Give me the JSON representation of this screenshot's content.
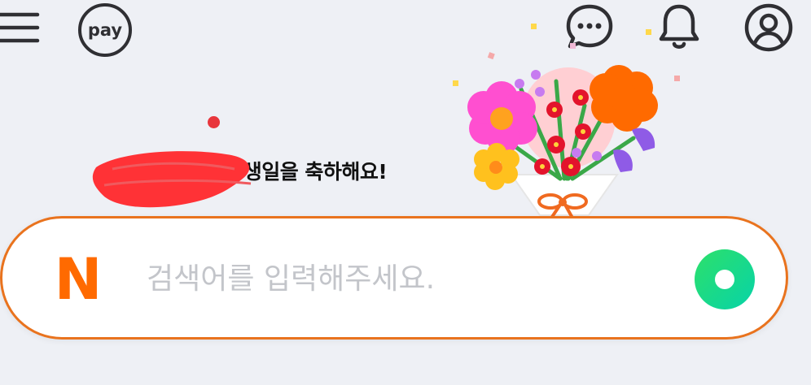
{
  "header": {
    "menu_icon": "hamburger-menu-icon",
    "pay_label": "pay",
    "talk_icon": "talk-bubble-icon",
    "notification_icon": "bell-icon",
    "profile_icon": "user-profile-icon"
  },
  "greeting": {
    "name_redacted": "",
    "message": "님 생일을 축하해요!"
  },
  "illustration": "birthday-bouquet",
  "search": {
    "logo_text": "N",
    "placeholder": "검색어를 입력해주세요.",
    "value": "",
    "button_icon": "green-circle-search-icon"
  },
  "colors": {
    "background": "#eef0f5",
    "accent_orange": "#ff6a00",
    "search_border": "#e9731e",
    "search_button_green": "#10d87e",
    "notification_dot": "#e8363c"
  }
}
